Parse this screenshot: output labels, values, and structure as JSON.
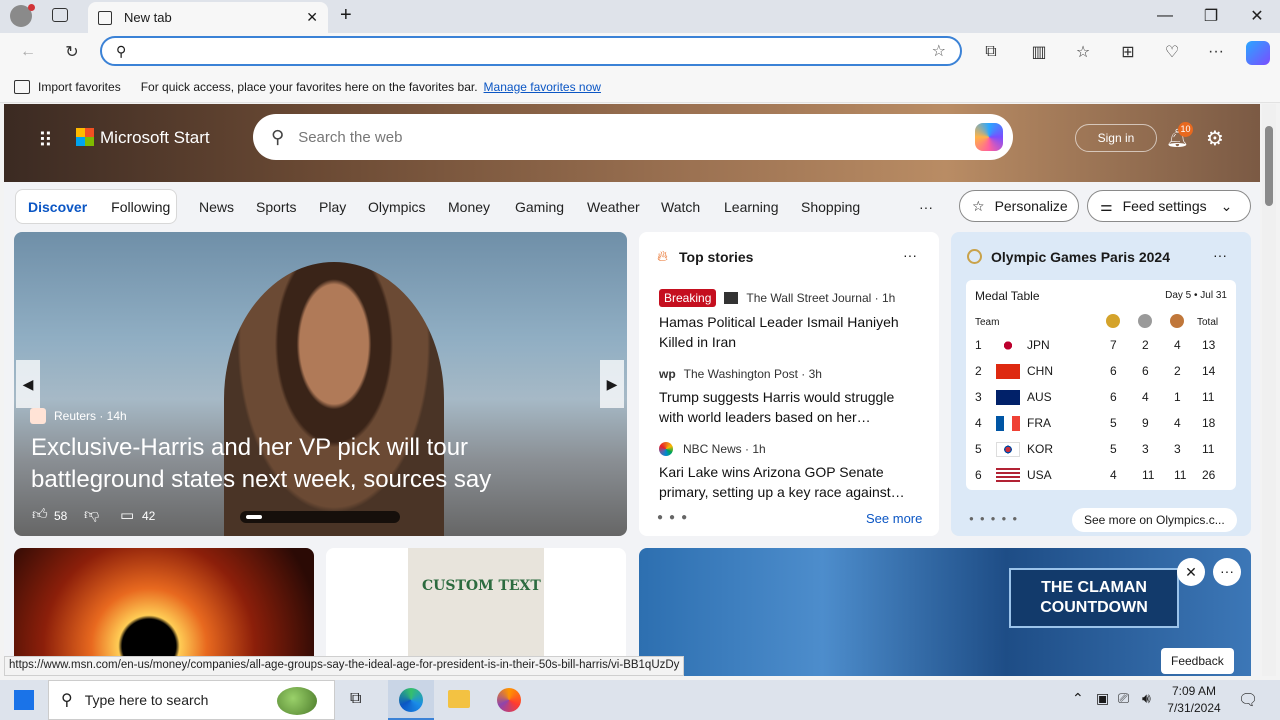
{
  "browser": {
    "tab_title": "New tab",
    "favorites_bar": {
      "import": "Import favorites",
      "hint": "For quick access, place your favorites here on the favorites bar.",
      "manage_link": "Manage favorites now"
    }
  },
  "msn": {
    "brand": "Microsoft Start",
    "search_placeholder": "Search the web",
    "sign_in": "Sign in",
    "notification_count": "10",
    "tabs": [
      "Discover",
      "Following"
    ],
    "nav": [
      "News",
      "Sports",
      "Play",
      "Olympics",
      "Money",
      "Gaming",
      "Weather",
      "Watch",
      "Learning",
      "Shopping"
    ],
    "more": "···",
    "personalize": "Personalize",
    "feed_settings": "Feed settings"
  },
  "hero": {
    "source": "Reuters · 14h",
    "title": "Exclusive-Harris and her VP pick will tour battleground states next week, sources say",
    "likes": "58",
    "comments": "42"
  },
  "top_stories": {
    "title": "Top stories",
    "items": [
      {
        "badge": "Breaking",
        "source": "The Wall Street Journal · 1h",
        "headline": "Hamas Political Leader Ismail Haniyeh Killed in Iran"
      },
      {
        "badge": "",
        "source": "The Washington Post · 3h",
        "headline": "Trump suggests Harris would struggle with world leaders based on her…"
      },
      {
        "badge": "",
        "source": "NBC News · 1h",
        "headline": "Kari Lake wins Arizona GOP Senate primary, setting up a key race against…"
      }
    ],
    "see_more": "See more"
  },
  "olympics": {
    "title": "Olympic Games Paris 2024",
    "table_title": "Medal Table",
    "day": "Day 5 • Jul 31",
    "col_team": "Team",
    "col_total": "Total",
    "rows": [
      {
        "rank": "1",
        "team": "JPN",
        "gold": "7",
        "silver": "2",
        "bronze": "4",
        "total": "13"
      },
      {
        "rank": "2",
        "team": "CHN",
        "gold": "6",
        "silver": "6",
        "bronze": "2",
        "total": "14"
      },
      {
        "rank": "3",
        "team": "AUS",
        "gold": "6",
        "silver": "4",
        "bronze": "1",
        "total": "11"
      },
      {
        "rank": "4",
        "team": "FRA",
        "gold": "5",
        "silver": "9",
        "bronze": "4",
        "total": "18"
      },
      {
        "rank": "5",
        "team": "KOR",
        "gold": "5",
        "silver": "3",
        "bronze": "3",
        "total": "11"
      },
      {
        "rank": "6",
        "team": "USA",
        "gold": "4",
        "silver": "11",
        "bronze": "11",
        "total": "26"
      }
    ],
    "see_more": "See more on Olympics.c..."
  },
  "bottom": {
    "shirt_text": "CUSTOM TEXT",
    "tv_text": "THE CLAMAN COUNTDOWN",
    "feedback": "Feedback"
  },
  "status_url": "https://www.msn.com/en-us/money/companies/all-age-groups-say-the-ideal-age-for-president-is-in-their-50s-bill-harris/vi-BB1qUzDy",
  "taskbar": {
    "search": "Type here to search",
    "time": "7:09 AM",
    "date": "7/31/2024"
  },
  "colors": {
    "accent": "#0b56c4",
    "breaking": "#c50f1f",
    "medal_gold": "#d4a32b",
    "medal_silver": "#9a9a9a",
    "medal_bronze": "#c0773a"
  }
}
